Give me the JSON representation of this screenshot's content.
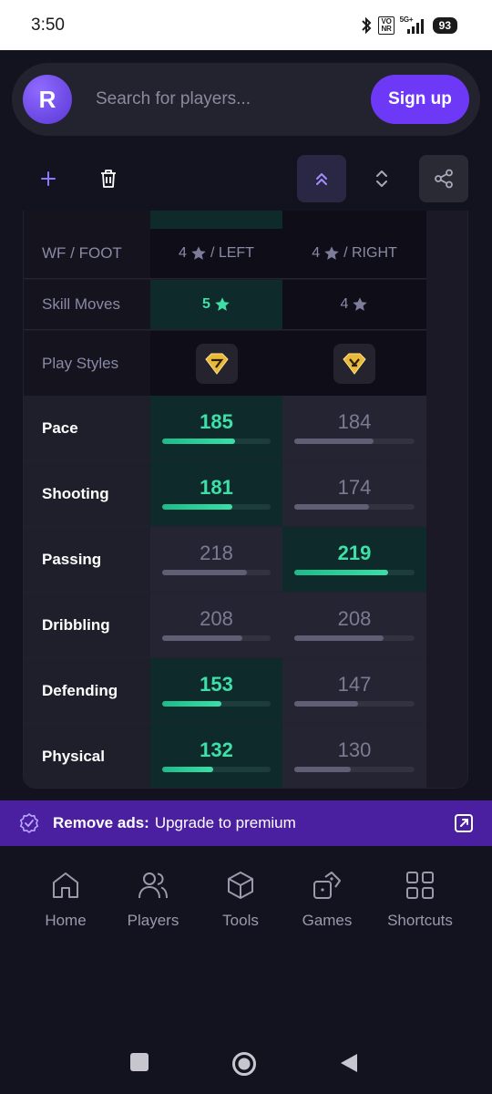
{
  "status_bar": {
    "time": "3:50",
    "network_label_top": "VO",
    "network_label_bottom": "NR",
    "network_type": "5G+",
    "battery": "93"
  },
  "header": {
    "logo_letter": "R",
    "search_placeholder": "Search for players...",
    "signup_label": "Sign up"
  },
  "info_rows": {
    "wf_foot": {
      "label": "WF / FOOT",
      "p1_num": "4",
      "p1_text": "/ LEFT",
      "p2_num": "4",
      "p2_text": "/ RIGHT"
    },
    "skill_moves": {
      "label": "Skill Moves",
      "p1": "5",
      "p2": "4"
    },
    "play_styles": {
      "label": "Play Styles"
    }
  },
  "stats": [
    {
      "label": "Pace",
      "p1": "185",
      "p2": "184",
      "p1_fill": 0.67,
      "p2_fill": 0.66,
      "winner": 1
    },
    {
      "label": "Shooting",
      "p1": "181",
      "p2": "174",
      "p1_fill": 0.65,
      "p2_fill": 0.62,
      "winner": 1
    },
    {
      "label": "Passing",
      "p1": "218",
      "p2": "219",
      "p1_fill": 0.78,
      "p2_fill": 0.78,
      "winner": 2
    },
    {
      "label": "Dribbling",
      "p1": "208",
      "p2": "208",
      "p1_fill": 0.74,
      "p2_fill": 0.74,
      "winner": 0
    },
    {
      "label": "Defending",
      "p1": "153",
      "p2": "147",
      "p1_fill": 0.55,
      "p2_fill": 0.53,
      "winner": 1
    },
    {
      "label": "Physical",
      "p1": "132",
      "p2": "130",
      "p1_fill": 0.47,
      "p2_fill": 0.47,
      "winner": 1
    }
  ],
  "promo": {
    "bold": "Remove ads:",
    "text": "Upgrade to premium"
  },
  "nav": {
    "home": "Home",
    "players": "Players",
    "tools": "Tools",
    "games": "Games",
    "shortcuts": "Shortcuts"
  },
  "colors": {
    "accent": "#6d39f6",
    "win_green": "#3ee0a8",
    "promo_bg": "#4a1fa0"
  }
}
